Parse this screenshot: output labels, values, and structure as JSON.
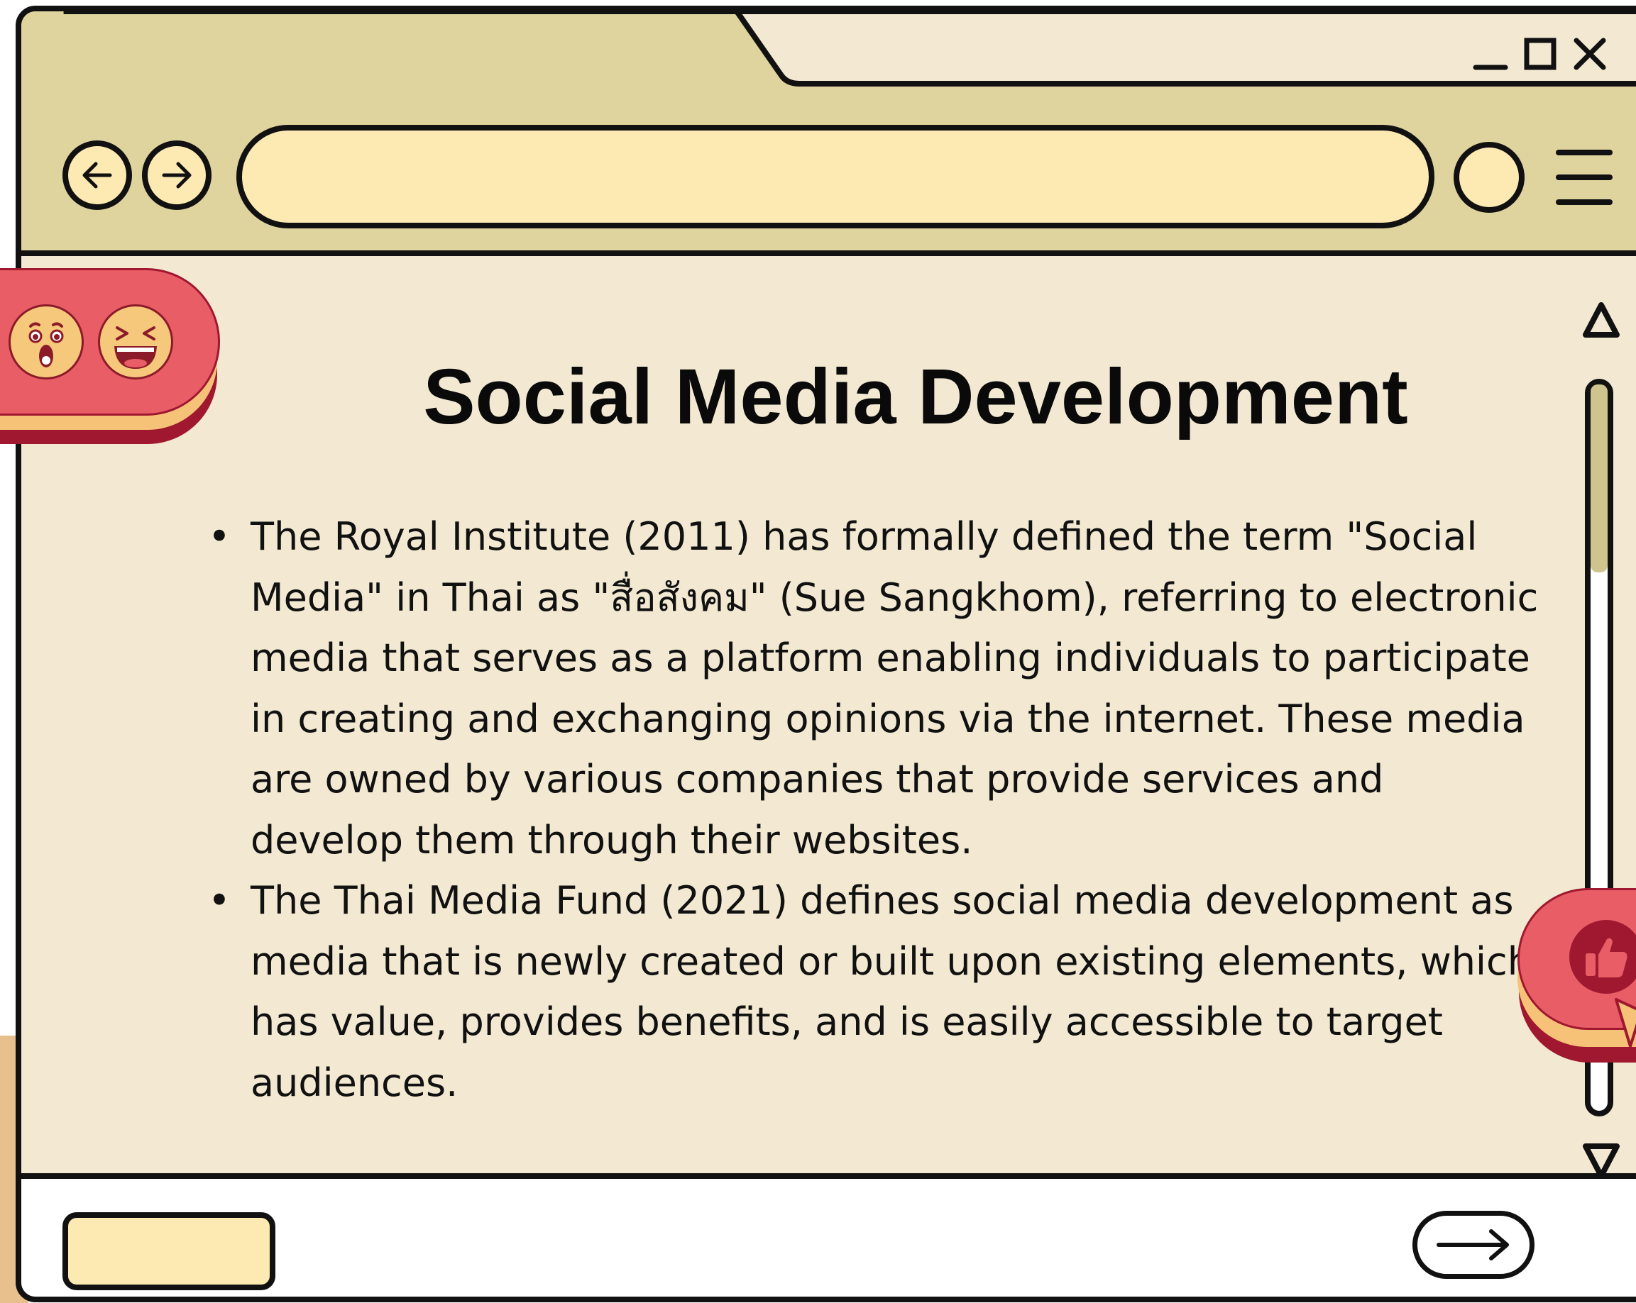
{
  "window": {
    "controls": [
      "minimize",
      "maximize",
      "close"
    ]
  },
  "toolbar": {
    "back_icon": "arrow-left-icon",
    "forward_icon": "arrow-right-icon",
    "address_value": "",
    "menu_icon": "hamburger-menu-icon"
  },
  "page": {
    "title": "Social Media Development",
    "bullets": [
      "The Royal Institute (2011) has formally defined the term \"Social Media\" in Thai as \"สื่อสังคม\" (Sue Sangkhom), referring to electronic media that serves as a platform enabling individuals to participate in creating and exchanging opinions via the internet. These media are owned by various companies that provide services and develop them through their websites.",
      "The Thai Media Fund (2021) defines social media development as media that is newly created or built upon existing elements, which has value, provides benefits, and is easily accessible to target audiences."
    ]
  },
  "scrollbar": {
    "position": 0.0
  },
  "stickers": {
    "left": [
      "surprised-face-emoji",
      "laughing-face-emoji"
    ],
    "right": [
      "thumbs-up-icon",
      "cursor-arrow-icon"
    ]
  },
  "colors": {
    "chrome": "#dfd39e",
    "page_bg": "#f3e9d2",
    "field": "#fdeab3",
    "sticker_red": "#e85d66",
    "sticker_dark": "#a01830",
    "sticker_gold": "#f5c278"
  }
}
